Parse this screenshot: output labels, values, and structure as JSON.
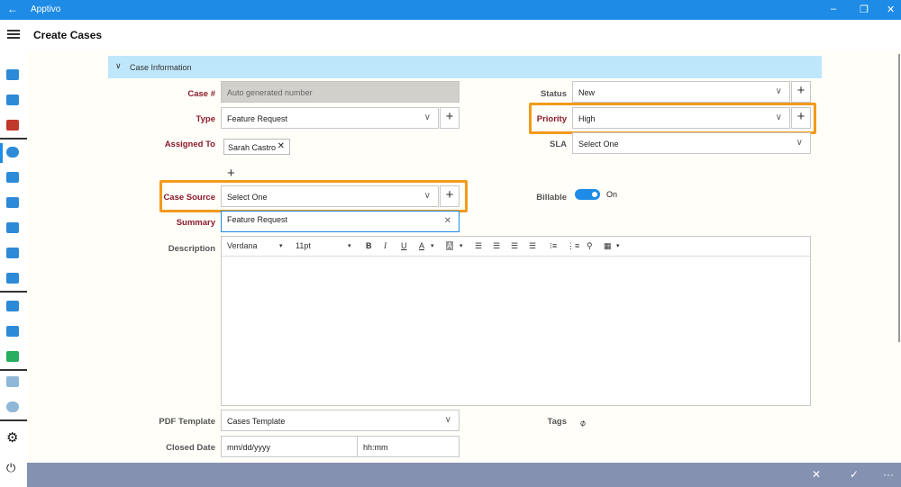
{
  "app": {
    "title": "Apptivo",
    "back_icon": "back-arrow-icon"
  },
  "window": {
    "minimize": "–",
    "restore": "❐",
    "close": "✕"
  },
  "header": {
    "title": "Create Cases"
  },
  "section": {
    "title": "Case Information"
  },
  "fields": {
    "case_no": {
      "label": "Case #",
      "placeholder": "Auto generated number"
    },
    "type": {
      "label": "Type",
      "value": "Feature Request"
    },
    "assigned_to": {
      "label": "Assigned To",
      "chip": "Sarah Castro"
    },
    "case_source": {
      "label": "Case Source",
      "value": "Select One"
    },
    "summary": {
      "label": "Summary",
      "value": "Feature Request"
    },
    "description": {
      "label": "Description",
      "font": "Verdana",
      "size": "11pt"
    },
    "status": {
      "label": "Status",
      "value": "New"
    },
    "priority": {
      "label": "Priority",
      "value": "High"
    },
    "sla": {
      "label": "SLA",
      "value": "Select One"
    },
    "billable": {
      "label": "Billable",
      "state": "On"
    },
    "pdf_template": {
      "label": "PDF Template",
      "value": "Cases Template"
    },
    "tags": {
      "label": "Tags"
    },
    "closed_date": {
      "label": "Closed Date",
      "date_placeholder": "mm/dd/yyyy",
      "time_placeholder": "hh:mm"
    }
  },
  "toolbar": {
    "bold": "B",
    "italic": "I",
    "underline": "U",
    "font_color": "A",
    "bg_color": "A"
  },
  "colors": {
    "accent": "#1e8ce6",
    "highlight": "#f39a1c",
    "section_bg": "#bfe7fb",
    "bottom_bar": "#8591b0",
    "label_red": "#8b1a2a"
  }
}
